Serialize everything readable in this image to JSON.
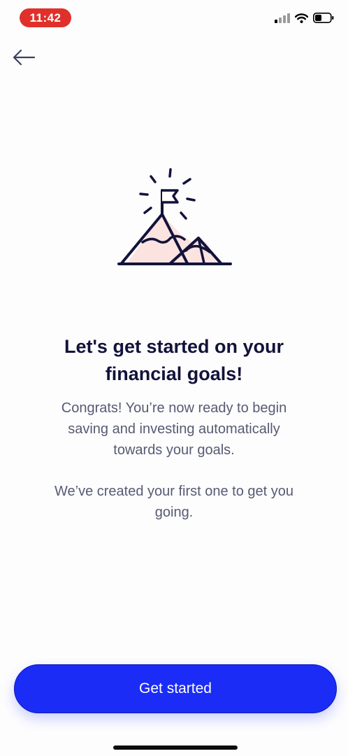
{
  "status_bar": {
    "time": "11:42",
    "signal_icon": "cellular-signal-icon",
    "wifi_icon": "wifi-icon",
    "battery_icon": "battery-icon"
  },
  "nav": {
    "back_icon": "arrow-left-icon"
  },
  "illustration": {
    "icon": "mountain-peak-flag-icon"
  },
  "content": {
    "headline_line1": "Let's get started on your",
    "headline_line2": "financial goals!",
    "paragraph1_line1": "Congrats! You’re now ready to begin",
    "paragraph1_line2": "saving and investing automatically",
    "paragraph1_line3": "towards your goals.",
    "paragraph2_line1": "We’ve created your first one to get you",
    "paragraph2_line2": "going."
  },
  "actions": {
    "primary_label": "Get started"
  },
  "colors": {
    "accent": "#1b2cf7",
    "ink": "#12133a",
    "muted_text": "#575a72",
    "mountain_fill": "#fbe3e0",
    "time_pill": "#e0302b"
  }
}
